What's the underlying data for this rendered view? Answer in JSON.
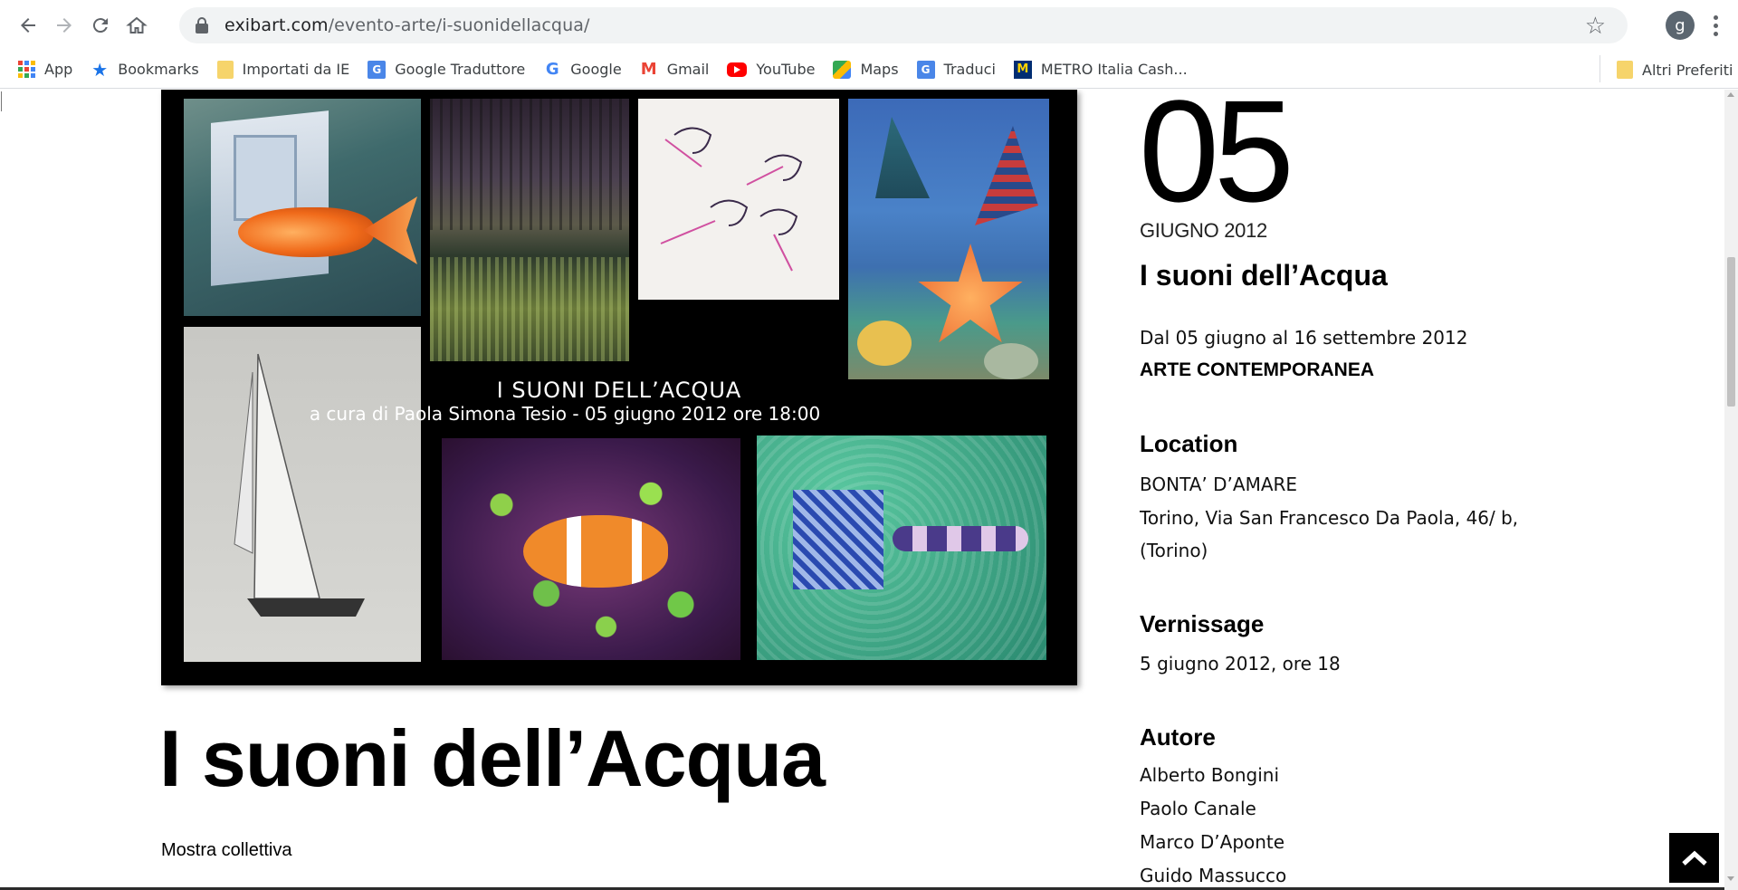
{
  "browser": {
    "url_domain": "exibart.com",
    "url_path": "/evento-arte/i-suonidellacqua/",
    "profile_initial": "g"
  },
  "bookmarks": [
    {
      "label": "App",
      "icon": "apps-icon"
    },
    {
      "label": "Bookmarks",
      "icon": "star-icon"
    },
    {
      "label": "Importati da IE",
      "icon": "folder-icon"
    },
    {
      "label": "Google Traduttore",
      "icon": "google-translate-icon"
    },
    {
      "label": "Google",
      "icon": "google-icon"
    },
    {
      "label": "Gmail",
      "icon": "gmail-icon"
    },
    {
      "label": "YouTube",
      "icon": "youtube-icon"
    },
    {
      "label": "Maps",
      "icon": "maps-icon"
    },
    {
      "label": "Traduci",
      "icon": "google-translate-icon"
    },
    {
      "label": "METRO Italia Cash...",
      "icon": "metro-icon"
    }
  ],
  "other_bookmarks": "Altri Preferiti",
  "hero": {
    "caption_title": "I SUONI DELL’ACQUA",
    "caption_sub": "a cura di Paola Simona Tesio - 05 giugno 2012 ore 18:00"
  },
  "main": {
    "title": "I suoni dell’Acqua",
    "subtitle": "Mostra collettiva"
  },
  "side": {
    "day": "05",
    "month_year": "GIUGNO 2012",
    "title": "I suoni dell’Acqua",
    "dates": "Dal 05 giugno al 16 settembre 2012",
    "category": "ARTE CONTEMPORANEA",
    "location_heading": "Location",
    "location_name": "BONTA’ D’AMARE",
    "location_address_1": "Torino, Via San Francesco Da Paola, 46/ b,",
    "location_address_2": "(Torino)",
    "vernissage_heading": "Vernissage",
    "vernissage_text": "5 giugno 2012, ore 18",
    "author_heading": "Autore",
    "authors": [
      "Alberto Bongini",
      "Paolo Canale",
      "Marco D’Aponte",
      "Guido Massucco"
    ]
  },
  "colors": {
    "accent": "#000000",
    "chrome_bg": "#f1f3f4"
  }
}
